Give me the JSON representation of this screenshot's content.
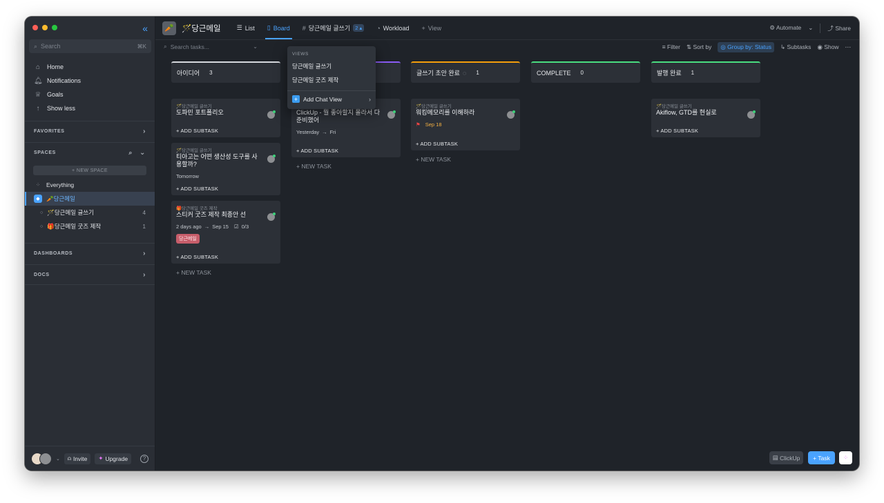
{
  "colors": {
    "accent": "#4aa3ff",
    "close": "#ff5f57",
    "minimize": "#febc2e",
    "maximize": "#28c840",
    "tag": "#c75d6a"
  },
  "sidebar": {
    "search_placeholder": "Search",
    "search_shortcut": "⌘K",
    "nav": [
      {
        "label": "Home",
        "icon": "home-icon"
      },
      {
        "label": "Notifications",
        "icon": "bell-icon"
      },
      {
        "label": "Goals",
        "icon": "trophy-icon"
      },
      {
        "label": "Show less",
        "icon": "arrow-up-icon"
      }
    ],
    "favorites": "FAVORITES",
    "spaces": "SPACES",
    "new_space": "+ NEW SPACE",
    "everything": "Everything",
    "space_name": "🥕당근메일",
    "lists": [
      {
        "label": "🪄당근메일 글쓰기",
        "count": "4"
      },
      {
        "label": "🎁당근메일 굿즈 제작",
        "count": "1"
      }
    ],
    "dashboards": "DASHBOARDS",
    "docs": "DOCS",
    "invite": "Invite",
    "upgrade": "Upgrade",
    "help": "?"
  },
  "topbar": {
    "space_title": "🪄당근메일",
    "tabs": {
      "list": "List",
      "board": "Board",
      "writing": "당근메일 글쓰기",
      "writing_badge": "2",
      "workload": "Workload",
      "view": "View"
    },
    "automate": "Automate",
    "share": "Share"
  },
  "toolbar": {
    "search_placeholder": "Search tasks...",
    "filter": "Filter",
    "sort": "Sort by",
    "group": "Group by: Status",
    "subtasks": "Subtasks",
    "show": "Show"
  },
  "dropdown": {
    "header": "VIEWS",
    "options": [
      "당근메일 글쓰기",
      "당근메일 굿즈 제작"
    ],
    "add_chat": "Add Chat View"
  },
  "columns": [
    {
      "name": "아이디어",
      "count": "3",
      "color": "#d6d9de"
    },
    {
      "name": "",
      "count": "",
      "color": "#8b5cf6"
    },
    {
      "name": "글쓰기 초안 완료",
      "count": "1",
      "color": "#f59e0b"
    },
    {
      "name": "COMPLETE",
      "count": "0",
      "color": "#4ade80"
    },
    {
      "name": "발행 완료",
      "count": "1",
      "color": "#4ade80"
    }
  ],
  "cards": {
    "c1": {
      "crumb": "🪄당근메일 글쓰기",
      "title": "도파민 포트폴리오",
      "add": "+ ADD SUBTASK"
    },
    "c2": {
      "crumb": "🪄당근메일 글쓰기",
      "title": "티아고는 어떤 생산성 도구를 사용할까?",
      "due": "Tomorrow",
      "add": "+ ADD SUBTASK"
    },
    "c3": {
      "crumb": "🎁당근메일 굿즈 제작",
      "title": "스티커 굿즈 제작 최종안 선",
      "start": "2 days ago",
      "end": "Sep 15",
      "checklist": "0/3",
      "tag": "당근메일",
      "add": "+ ADD SUBTASK"
    },
    "c4": {
      "title": "ClickUp - 뭘 좋아할지 몰라서 다 준비했어",
      "start": "Yesterday",
      "end": "Fri",
      "add": "+ ADD SUBTASK"
    },
    "c5": {
      "crumb": "🪄당근메일 글쓰기",
      "title": "워킹메모리를 이해하라",
      "due": "Sep 18",
      "add": "+ ADD SUBTASK"
    },
    "c6": {
      "crumb": "🪄당근메일 글쓰기",
      "title": "Akiflow, GTD를 현실로",
      "add": "+ ADD SUBTASK"
    }
  },
  "new_task": "+ NEW TASK",
  "bottom": {
    "clickup": "ClickUp",
    "task": "Task"
  }
}
